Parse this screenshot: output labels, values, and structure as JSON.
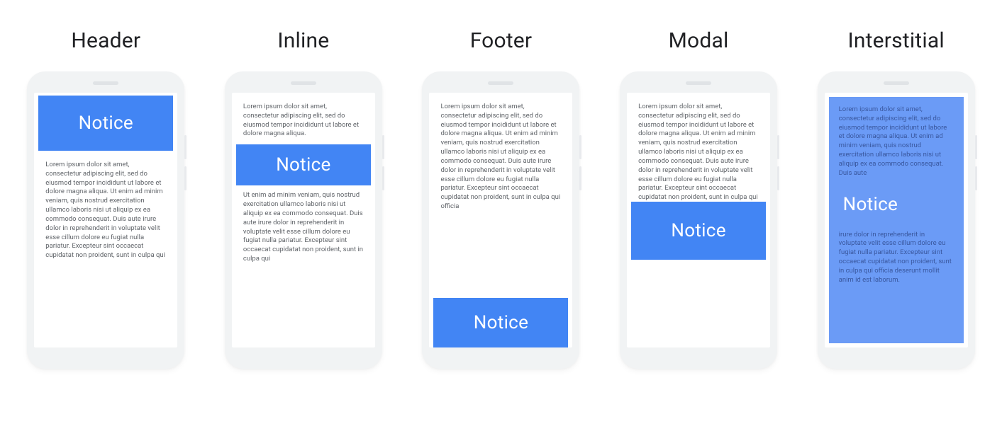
{
  "notice_label": "Notice",
  "variants": [
    {
      "id": "header",
      "title": "Header"
    },
    {
      "id": "inline",
      "title": "Inline"
    },
    {
      "id": "footer",
      "title": "Footer"
    },
    {
      "id": "modal",
      "title": "Modal"
    },
    {
      "id": "interstitial",
      "title": "Interstitial"
    }
  ],
  "lorem": {
    "short": "Lorem ipsum dolor sit amet, consectetur adipiscing elit, sed do eiusmod tempor incididunt ut labore et dolore magna aliqua.",
    "medium": "Lorem ipsum dolor sit amet, consectetur adipiscing elit, sed do eiusmod tempor incididunt ut labore et dolore magna aliqua. Ut enim ad minim veniam, quis nostrud exercitation ullamco laboris nisi ut aliquip ex ea commodo consequat. Duis aute irure dolor in reprehenderit in voluptate velit esse cillum dolore eu fugiat nulla pariatur. Excepteur sint occaecat cupidatat non proident, sunt in culpa qui",
    "inline_bottom": "Ut enim ad minim veniam, quis nostrud exercitation ullamco laboris nisi ut aliquip ex ea commodo consequat. Duis aute irure dolor in reprehenderit in voluptate velit esse cillum dolore eu fugiat nulla pariatur. Excepteur sint occaecat cupidatat non proident, sunt in culpa qui",
    "footer_body": "Lorem ipsum dolor sit amet, consectetur adipiscing elit, sed do eiusmod tempor incididunt ut labore et dolore magna aliqua. Ut enim ad minim veniam, quis nostrud exercitation ullamco laboris nisi ut aliquip ex ea commodo consequat. Duis aute irure dolor in reprehenderit in voluptate velit esse cillum dolore eu fugiat nulla pariatur. Excepteur sint occaecat cupidatat non proident, sunt in culpa qui officia",
    "modal_body": "Lorem ipsum dolor sit amet, consectetur adipiscing elit, sed do eiusmod tempor incididunt ut labore et dolore magna aliqua. Ut enim ad minim veniam, quis nostrud exercitation ullamco laboris nisi ut aliquip ex ea commodo consequat. Duis aute irure dolor in reprehenderit in voluptate velit esse cillum dolore eu fugiat nulla pariatur. Excepteur sint occaecat cupidatat non proident, sunt in culpa qui officia deserunt mollit anim id est laborum.",
    "interstitial_top": "Lorem ipsum dolor sit amet, consectetur adipiscing elit, sed do eiusmod tempor incididunt ut labore et dolore magna aliqua. Ut enim ad minim veniam, quis nostrud exercitation ullamco laboris nisi ut aliquip ex ea commodo consequat. Duis aute",
    "interstitial_bottom": "irure dolor in reprehenderit in voluptate velit esse cillum dolore eu fugiat nulla pariatur. Excepteur sint occaecat cupidatat non proident, sunt in culpa qui officia deserunt mollit anim id est laborum."
  },
  "colors": {
    "notice_bg": "#4285f4",
    "interstitial_bg": "#6b9bf6",
    "phone_body": "#f1f3f4",
    "body_text": "#5f6368",
    "title_text": "#202124"
  }
}
